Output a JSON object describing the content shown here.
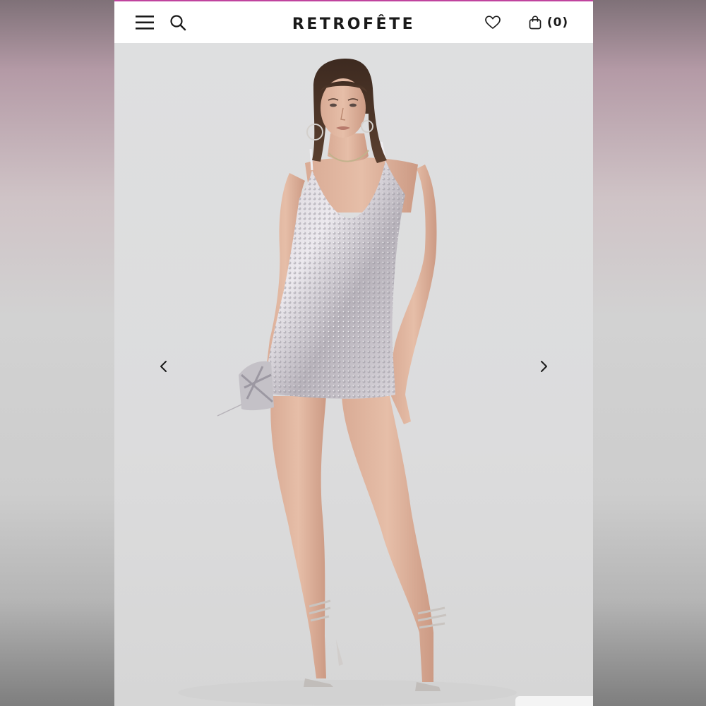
{
  "header": {
    "brand": "RETROFÊTE",
    "bag_count": "(0)",
    "icons": {
      "menu": "hamburger-menu-icon",
      "search": "search-icon",
      "wishlist": "heart-icon",
      "bag": "shopping-bag-icon"
    },
    "accent_color": "#c0439e"
  },
  "gallery": {
    "image": "model-in-silver-sequin-mini-dress",
    "prev_icon": "chevron-left-icon",
    "next_icon": "chevron-right-icon"
  }
}
